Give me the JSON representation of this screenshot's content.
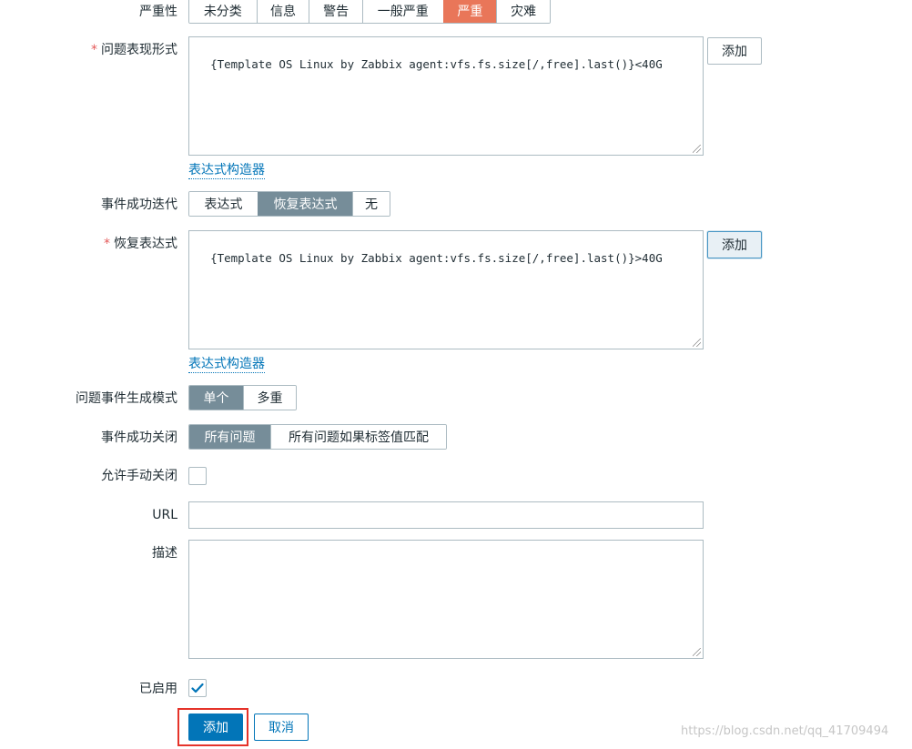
{
  "severity": {
    "label": "严重性",
    "options": [
      "未分类",
      "信息",
      "警告",
      "一般严重",
      "严重",
      "灾难"
    ],
    "selected": "严重"
  },
  "problem_expression": {
    "label": "问题表现形式",
    "value": "{Template OS Linux by Zabbix agent:vfs.fs.size[/,free].last()}<40G",
    "add_button": "添加",
    "builder_link": "表达式构造器"
  },
  "ok_event_generation": {
    "label": "事件成功迭代",
    "options": [
      "表达式",
      "恢复表达式",
      "无"
    ],
    "selected": "恢复表达式"
  },
  "recovery_expression": {
    "label": "恢复表达式",
    "value": "{Template OS Linux by Zabbix agent:vfs.fs.size[/,free].last()}>40G",
    "add_button": "添加",
    "builder_link": "表达式构造器"
  },
  "problem_event_mode": {
    "label": "问题事件生成模式",
    "options": [
      "单个",
      "多重"
    ],
    "selected": "单个"
  },
  "ok_event_closes": {
    "label": "事件成功关闭",
    "options": [
      "所有问题",
      "所有问题如果标签值匹配"
    ],
    "selected": "所有问题"
  },
  "manual_close": {
    "label": "允许手动关闭",
    "checked": false
  },
  "url": {
    "label": "URL",
    "value": ""
  },
  "description": {
    "label": "描述",
    "value": ""
  },
  "enabled": {
    "label": "已启用",
    "checked": true
  },
  "actions": {
    "add": "添加",
    "cancel": "取消"
  },
  "watermark": "https://blog.csdn.net/qq_41709494",
  "colors": {
    "selected_segment": "#768d99",
    "high_severity": "#e97659",
    "primary": "#0275b8",
    "highlight_box": "#e5332a"
  }
}
